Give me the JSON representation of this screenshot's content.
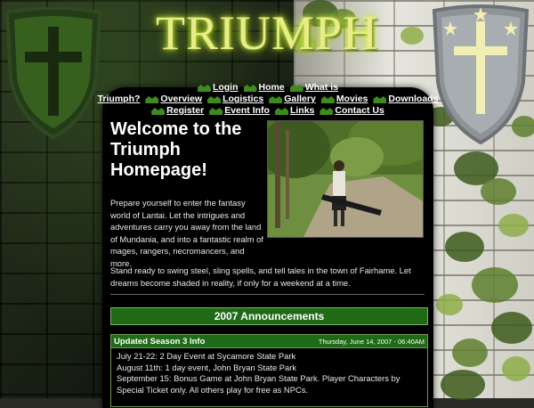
{
  "site_title": "TRIUMPH",
  "nav": {
    "row1": [
      {
        "label": "Login",
        "icon": "leaf-icon"
      },
      {
        "label": "Home",
        "icon": "leaf-icon"
      },
      {
        "label": "What is",
        "icon": "leaf-icon"
      }
    ],
    "row2": [
      {
        "label": "Triumph?",
        "icon": ""
      },
      {
        "label": "Overview",
        "icon": "leaf-icon"
      },
      {
        "label": "Logistics",
        "icon": "leaf-icon"
      },
      {
        "label": "Gallery",
        "icon": "leaf-icon"
      },
      {
        "label": "Movies",
        "icon": "leaf-icon"
      },
      {
        "label": "Downloads",
        "icon": "leaf-icon"
      }
    ],
    "row3": [
      {
        "label": "Register",
        "icon": "leaf-icon"
      },
      {
        "label": "Event Info",
        "icon": "leaf-icon"
      },
      {
        "label": "Links",
        "icon": "leaf-icon"
      },
      {
        "label": "Contact Us",
        "icon": "leaf-icon"
      }
    ]
  },
  "welcome": {
    "heading": "Welcome to the Triumph Homepage!",
    "intro": "Prepare yourself to enter the fantasy world of Lantai. Let the intrigues and adventures carry you away from the land of Mundania, and into a fantastic realm of mages, rangers, necromancers, and more.",
    "stand": "Stand ready to swing steel, sling spells, and tell tales in the town of Fairhame. Let dreams become shaded in reality, if only for a weekend at a time."
  },
  "announcements": {
    "heading": "2007 Announcements",
    "post_title": "Updated Season 3 Info",
    "post_date": "Thursday, June 14, 2007 - 06:40AM",
    "lines": [
      "July 21-22: 2 Day Event at Sycamore State Park",
      "August 11th: 1 day event, John Bryan State Park",
      "September 15: Bonus Game at John Bryan State Park. Player Characters by Special Ticket only. All others play for free as NPCs."
    ]
  },
  "colors": {
    "panel": "#000000",
    "accent_green": "#1f6a16",
    "title_glow": "#d8ff40"
  }
}
